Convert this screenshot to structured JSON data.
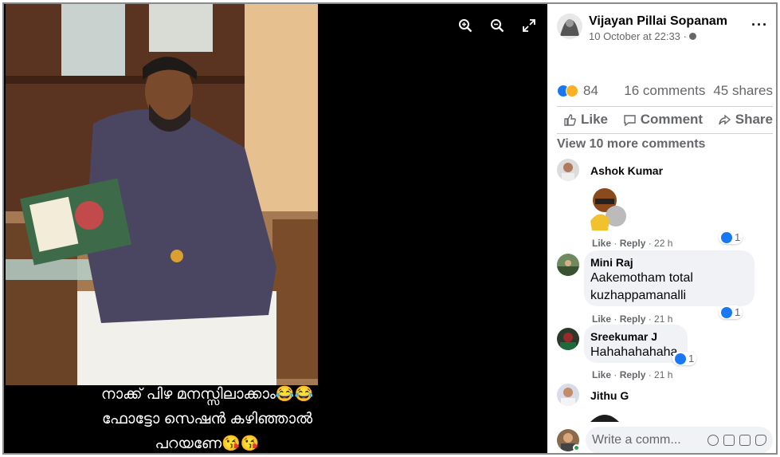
{
  "viewer": {
    "tools": [
      "zoom-in-icon",
      "zoom-out-icon",
      "fullscreen-icon"
    ],
    "caption_lines": [
      "നാക്ക് പിഴ മനസ്സിലാക്കാം😂😂",
      "ഫോട്ടോ സെഷൻ കഴിഞ്ഞാൽ",
      "പറയണേ😘😘"
    ]
  },
  "post": {
    "author": "Vijayan Pillai Sopanam",
    "timestamp": "10 October at 22:33 ·",
    "reaction_count": "84",
    "comments_count": "16 comments",
    "shares_count": "45 shares",
    "actions": {
      "like": "Like",
      "comment": "Comment",
      "share": "Share"
    },
    "view_more": "View 10 more comments"
  },
  "comments": [
    {
      "name": "Ashok Kumar",
      "text": "",
      "like": "Like",
      "reply": "Reply",
      "time": "· 22 h",
      "likes": "1"
    },
    {
      "name": "Mini Raj",
      "text1": "Aakemotham total",
      "text2": "kuzhappamanalli",
      "like": "Like",
      "reply": "Reply",
      "time": "· 21 h",
      "likes": "1"
    },
    {
      "name": "Sreekumar J",
      "text": "Hahahahahaha",
      "like": "Like",
      "reply": "Reply",
      "time": "· 21 h",
      "likes": "1"
    },
    {
      "name": "Jithu G"
    }
  ],
  "composer": {
    "placeholder": "Write a comm..."
  },
  "colors": {
    "accent": "#1877f2",
    "haha": "#f7b125",
    "online": "#31a24c"
  }
}
